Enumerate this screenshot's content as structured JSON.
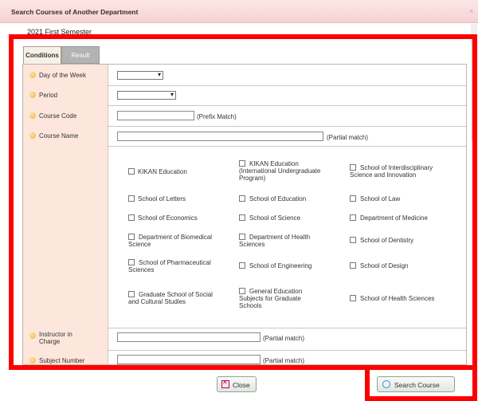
{
  "window": {
    "title": "Search Courses of Another Department",
    "close": "×"
  },
  "semester": "2021 First Semester",
  "tabs": [
    {
      "label": "Conditions"
    },
    {
      "label": "Result"
    }
  ],
  "fields": {
    "day": {
      "label": "Day of the Week",
      "value": ""
    },
    "period": {
      "label": "Period",
      "value": ""
    },
    "course_code": {
      "label": "Course Code",
      "value": "",
      "note": "(Prefix Match)"
    },
    "course_name": {
      "label": "Course Name",
      "value": "",
      "note": "(Partial match)"
    },
    "instructor": {
      "label": "Instructor in Charge",
      "value": "",
      "note": "(Partial match)"
    },
    "subject_number": {
      "label": "Subject Number",
      "value": "",
      "note": "(Partial match)"
    }
  },
  "departments": [
    "KIKAN Education",
    "KIKAN Education (International Undergraduate Program)",
    "School of Interdisciplinary Science and Innovation",
    "School of Letters",
    "School of Education",
    "School of Law",
    "School of Economics",
    "School of Science",
    "Department of Medicine",
    "Department of Biomedical Science",
    "Department of Health Sciences",
    "School of Dentistry",
    "School of Pharmaceutical Sciences",
    "School of Engineering",
    "School of Design",
    "Graduate School of Social and Cultural Studies",
    "General Education Subjects for Graduate Schools",
    "School of Health Sciences"
  ],
  "buttons": {
    "close": "Close",
    "search": "Search Course"
  },
  "colors": {
    "highlight": "#ff0000",
    "label_bg": "#fde6dc",
    "title_bg": "#f6d3d3"
  },
  "icons": [
    "bullet-dot-icon",
    "close-x-icon",
    "search-magnifier-icon"
  ]
}
